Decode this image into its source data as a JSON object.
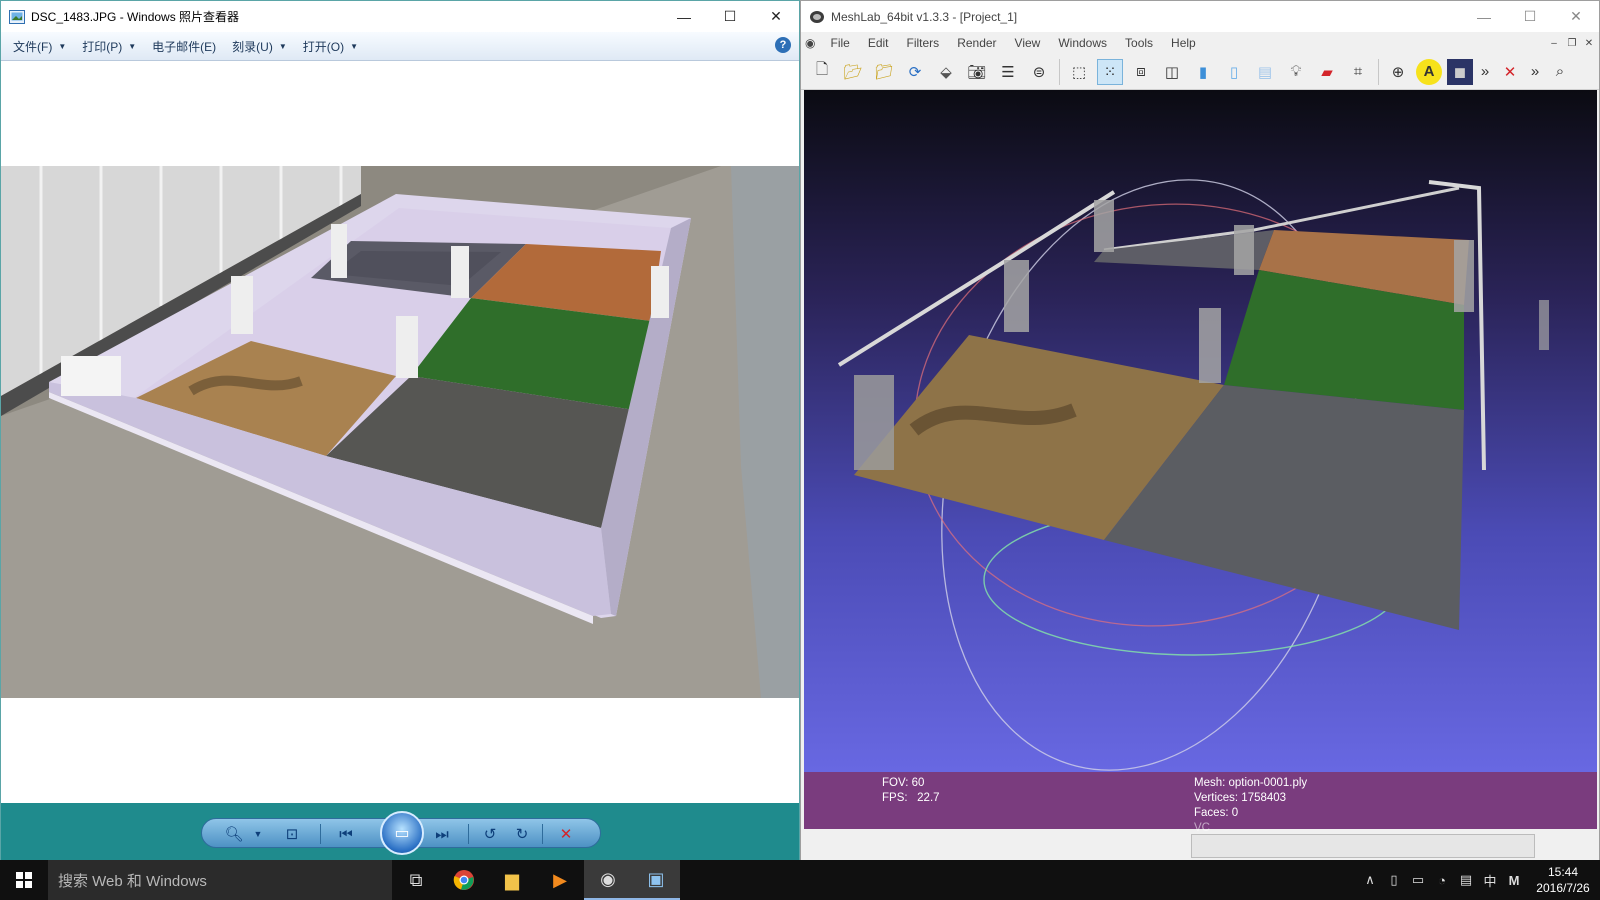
{
  "photo_viewer": {
    "title": "DSC_1483.JPG - Windows 照片查看器",
    "menu": [
      {
        "label": "文件(F)"
      },
      {
        "label": "打印(P)"
      },
      {
        "label": "电子邮件(E)"
      },
      {
        "label": "刻录(U)"
      },
      {
        "label": "打开(O)"
      }
    ],
    "help_label": "?"
  },
  "meshlab": {
    "title": "MeshLab_64bit v1.3.3 - [Project_1]",
    "menu": [
      "File",
      "Edit",
      "Filters",
      "Render",
      "View",
      "Windows",
      "Tools",
      "Help"
    ],
    "info": {
      "fov": "FOV: 60",
      "fps_label": "FPS:",
      "fps_value": "22.7",
      "mesh": "Mesh: option-0001.ply",
      "vertices": "Vertices: 1758403",
      "faces": "Faces: 0",
      "vc": "VC"
    }
  },
  "taskbar": {
    "search_placeholder": "搜索 Web 和 Windows",
    "ime": "中",
    "ime2": "M",
    "time": "15:44",
    "date": "2016/7/26"
  }
}
